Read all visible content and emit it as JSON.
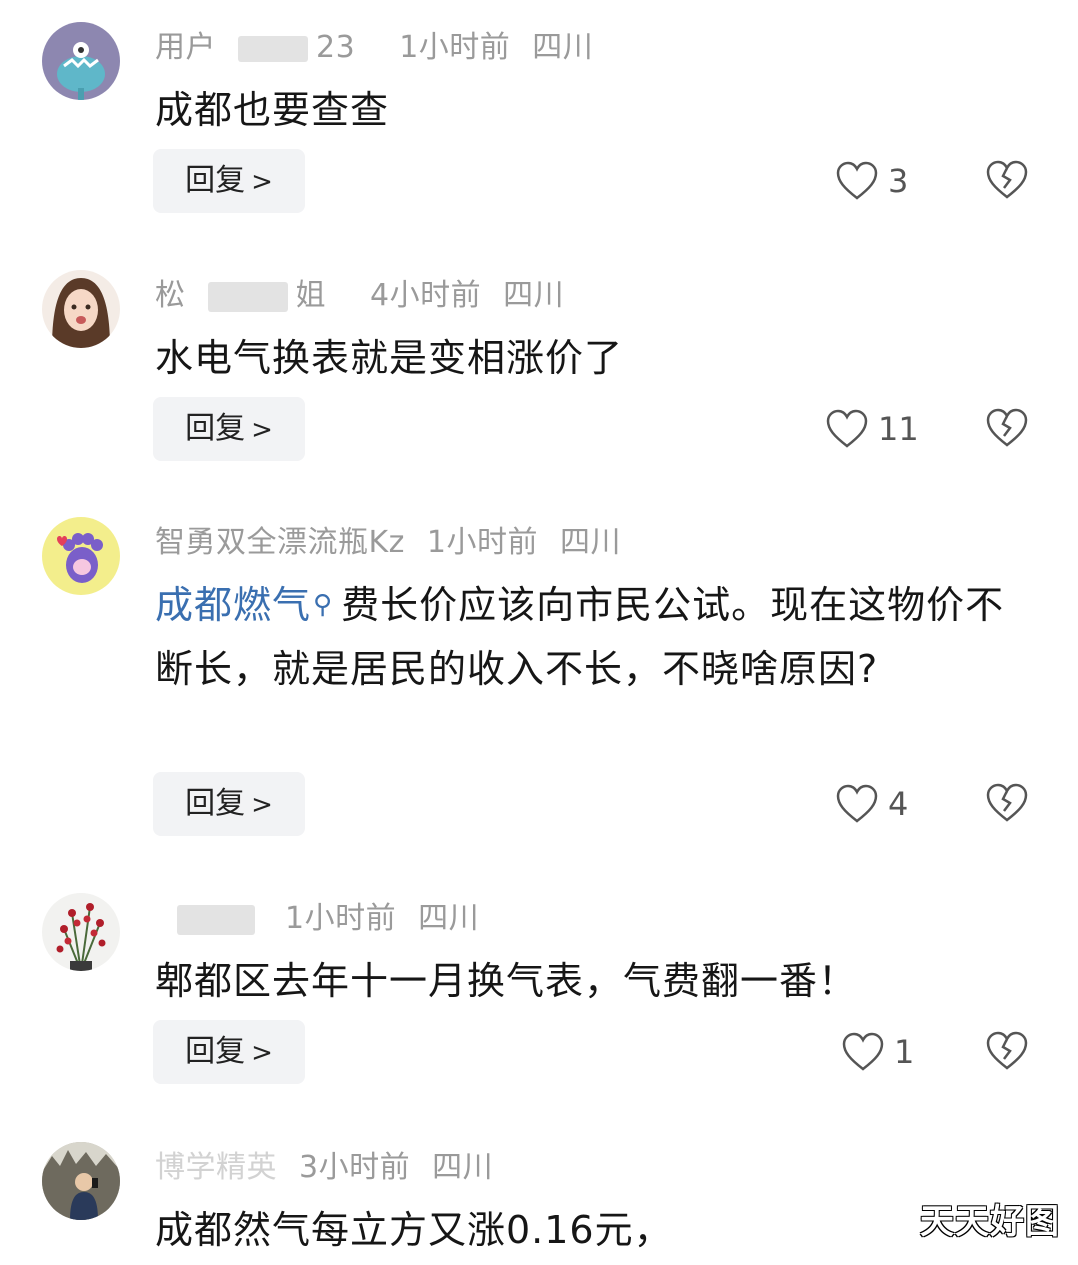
{
  "comments": [
    {
      "username": "用户",
      "username_tail": "23",
      "time": "1小时前",
      "location": "四川",
      "text": "成都也要查查",
      "reply_label": "回复",
      "likes": "3"
    },
    {
      "username": "松",
      "username_tail": "姐",
      "time": "4小时前",
      "location": "四川",
      "text": "水电气换表就是变相涨价了",
      "reply_label": "回复",
      "likes": "11"
    },
    {
      "username": "智勇双全漂流瓶Kz",
      "time": "1小时前",
      "location": "四川",
      "link": "成都燃气",
      "text": "费长价应该向市民公试。现在这物价不断长，就是居民的收入不长，不晓啥原因?",
      "reply_label": "回复",
      "likes": "4"
    },
    {
      "username": "",
      "time": "1小时前",
      "location": "四川",
      "text": "郫都区去年十一月换气表，气费翻一番！",
      "reply_label": "回复",
      "likes": "1"
    },
    {
      "username": "博学精英",
      "time": "3小时前",
      "location": "四川",
      "text": "成都然气每立方又涨0.16元，"
    }
  ],
  "watermark": "天天好图",
  "colors": {
    "link": "#3a6fb0",
    "meta": "#9a9a9a",
    "reply_bg": "#f2f3f5"
  },
  "icons": {
    "like": "heart-outline-icon",
    "dislike": "broken-heart-icon",
    "reply_arrow": "chevron-right-icon",
    "link": "search-icon"
  }
}
